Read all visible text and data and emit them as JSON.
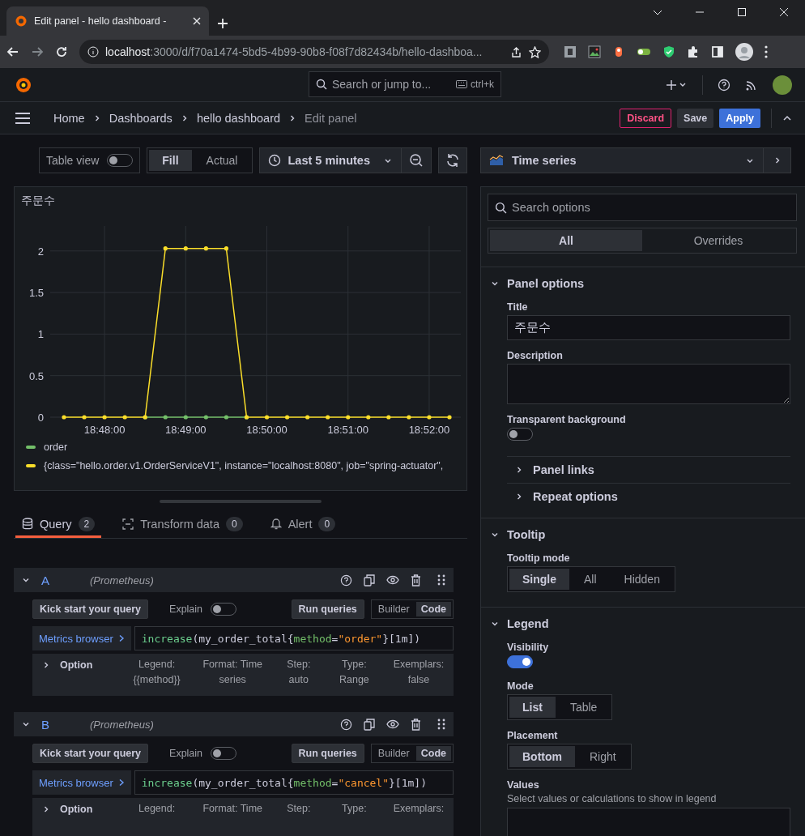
{
  "browser": {
    "tab_title": "Edit panel - hello dashboard - ",
    "url_host": "localhost",
    "url_rest": ":3000/d/f70a1474-5bd5-4b99-90b8-f08f7d82434b/hello-dashboa..."
  },
  "topnav": {
    "search_placeholder": "Search or jump to...",
    "shortcut": "ctrl+k"
  },
  "breadcrumbs": [
    {
      "label": "Home",
      "current": false
    },
    {
      "label": "Dashboards",
      "current": false
    },
    {
      "label": "hello dashboard",
      "current": false
    },
    {
      "label": "Edit panel",
      "current": true
    }
  ],
  "actions": [
    {
      "label": "Discard",
      "kind": "danger"
    },
    {
      "label": "Save",
      "kind": "secondary"
    },
    {
      "label": "Apply",
      "kind": "primary"
    }
  ],
  "toolbar": {
    "table_view": {
      "label": "Table view",
      "on": false
    },
    "size_modes": [
      {
        "label": "Fill",
        "selected": true
      },
      {
        "label": "Actual",
        "selected": false
      }
    ],
    "time_range": "Last 5 minutes"
  },
  "panel": {
    "title": "주문수",
    "chart_data": {
      "type": "line",
      "grid": true,
      "categories": [
        null,
        null,
        "18:48:00",
        null,
        null,
        null,
        "18:49:00",
        null,
        null,
        null,
        "18:50:00",
        null,
        null,
        null,
        "18:51:00",
        null,
        null,
        null,
        "18:52:00",
        null
      ],
      "series": [
        {
          "name": "order",
          "color": "#73bf69",
          "values": [
            null,
            null,
            null,
            null,
            0,
            0,
            0,
            0,
            0,
            0,
            null,
            null,
            null,
            null,
            null,
            null,
            null,
            null,
            null,
            null
          ]
        },
        {
          "name": "{class=\"hello.order.v1.OrderServiceV1\", instance=\"localhost:8080\", job=\"spring-actuator\",",
          "color": "#fade2a",
          "values": [
            0,
            0,
            0,
            0,
            0,
            2.03,
            2.03,
            2.03,
            2.03,
            0,
            0,
            0,
            0,
            0,
            0,
            0,
            0,
            0,
            0,
            0
          ]
        }
      ],
      "ylim": [
        0,
        2.3
      ],
      "yticks": [
        0,
        0.5,
        1,
        1.5,
        2
      ]
    }
  },
  "query_tabs": [
    {
      "label": "Query",
      "count": "2",
      "selected": true
    },
    {
      "label": "Transform data",
      "count": "0",
      "selected": false
    },
    {
      "label": "Alert",
      "count": "0",
      "selected": false
    }
  ],
  "queries": [
    {
      "ref": "A",
      "datasource": "(Prometheus)",
      "kick_start": "Kick start your query",
      "explain": {
        "label": "Explain",
        "on": false
      },
      "run": "Run queries",
      "editor_modes": [
        {
          "label": "Builder",
          "selected": false
        },
        {
          "label": "Code",
          "selected": true
        }
      ],
      "metrics_browser": "Metrics browser",
      "expr": [
        {
          "text": "increase",
          "kind": "function"
        },
        {
          "text": "(my_order_total{",
          "kind": "plain"
        },
        {
          "text": "method",
          "kind": "label"
        },
        {
          "text": "=",
          "kind": "plain"
        },
        {
          "text": "\"order\"",
          "kind": "string"
        },
        {
          "text": "}[1m])",
          "kind": "plain"
        }
      ],
      "options_label": "Option",
      "options": [
        "Legend: {{method}}",
        "Format: Time series",
        "Step: auto",
        "Type: Range",
        "Exemplars: false"
      ]
    },
    {
      "ref": "B",
      "datasource": "(Prometheus)",
      "kick_start": "Kick start your query",
      "explain": {
        "label": "Explain",
        "on": false
      },
      "run": "Run queries",
      "editor_modes": [
        {
          "label": "Builder",
          "selected": false
        },
        {
          "label": "Code",
          "selected": true
        }
      ],
      "metrics_browser": "Metrics browser",
      "expr": [
        {
          "text": "increase",
          "kind": "function"
        },
        {
          "text": "(my_order_total{",
          "kind": "plain"
        },
        {
          "text": "method",
          "kind": "label"
        },
        {
          "text": "=",
          "kind": "plain"
        },
        {
          "text": "\"cancel\"",
          "kind": "string"
        },
        {
          "text": "}[1m])",
          "kind": "plain"
        }
      ],
      "options_label": "Option",
      "options": [
        "Legend:",
        "Format: Time",
        "Step:",
        "Type:",
        "Exemplars:"
      ]
    }
  ],
  "options_pane": {
    "viz": "Time series",
    "search_placeholder": "Search options",
    "tabs": [
      {
        "label": "All",
        "selected": true
      },
      {
        "label": "Overrides",
        "selected": false
      }
    ],
    "sections": [
      {
        "title": "Panel options",
        "expanded": true,
        "items": [
          {
            "kind": "text",
            "label": "Title",
            "value": "주문수"
          },
          {
            "kind": "textarea",
            "label": "Description"
          },
          {
            "kind": "switch",
            "label": "Transparent background",
            "on": false
          },
          {
            "kind": "subsection",
            "label": "Panel links",
            "expanded": false
          },
          {
            "kind": "subsection",
            "label": "Repeat options",
            "expanded": false
          }
        ]
      },
      {
        "title": "Tooltip",
        "expanded": true,
        "items": [
          {
            "kind": "radio",
            "label": "Tooltip mode",
            "options": [
              {
                "label": "Single",
                "selected": true
              },
              {
                "label": "All",
                "selected": false
              },
              {
                "label": "Hidden",
                "selected": false
              }
            ]
          }
        ]
      },
      {
        "title": "Legend",
        "expanded": true,
        "items": [
          {
            "kind": "switch",
            "label": "Visibility",
            "on": true
          },
          {
            "kind": "radio",
            "label": "Mode",
            "options": [
              {
                "label": "List",
                "selected": true
              },
              {
                "label": "Table",
                "selected": false
              }
            ]
          },
          {
            "kind": "radio",
            "label": "Placement",
            "options": [
              {
                "label": "Bottom",
                "selected": true
              },
              {
                "label": "Right",
                "selected": false
              }
            ]
          },
          {
            "kind": "select",
            "label": "Values",
            "description": "Select values or calculations to show in legend"
          }
        ]
      }
    ]
  }
}
